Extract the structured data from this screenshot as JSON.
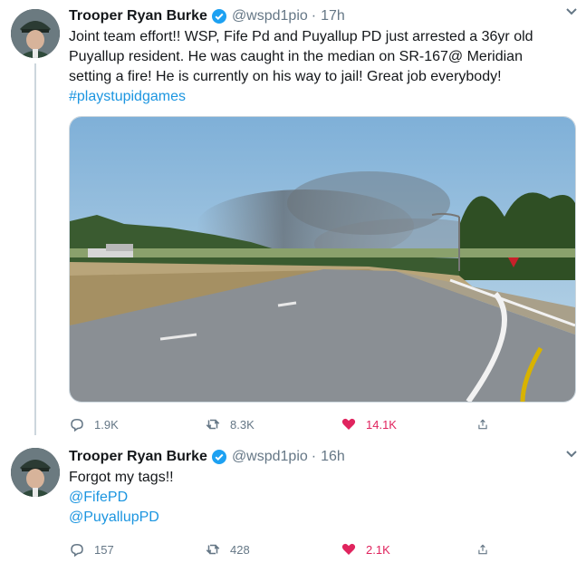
{
  "tweets": [
    {
      "name": "Trooper Ryan Burke",
      "handle": "@wspd1pio",
      "separator": "·",
      "time": "17h",
      "text_lines": [
        "Joint team effort!! WSP, Fife Pd and Puyallup PD just arrested a 36yr old",
        "Puyallup resident. He was caught in the median on SR-167@ Meridian",
        "setting a fire! He is currently on his way to jail! Great job everybody!"
      ],
      "hashtag": "#playstupidgames",
      "replies": "1.9K",
      "retweets": "8.3K",
      "likes": "14.1K"
    },
    {
      "name": "Trooper Ryan Burke",
      "handle": "@wspd1pio",
      "separator": "·",
      "time": "16h",
      "text": "Forgot my tags!!",
      "mentions": [
        "@FifePD",
        "@PuyallupPD"
      ],
      "replies": "157",
      "retweets": "428",
      "likes": "2.1K"
    }
  ],
  "colors": {
    "link": "#1b95e0",
    "secondary": "#657786",
    "like": "#e0245e",
    "verified": "#1da1f2"
  },
  "icons": [
    "verified-badge-icon",
    "chevron-down-icon",
    "reply-icon",
    "retweet-icon",
    "heart-icon",
    "share-icon"
  ]
}
